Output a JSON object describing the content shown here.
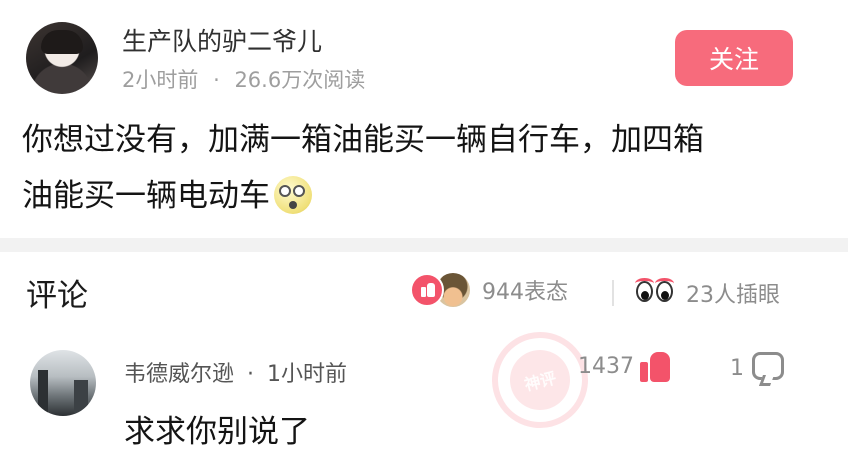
{
  "post": {
    "author": "生产队的驴二爷儿",
    "time": "2小时前",
    "dot": "·",
    "reads": "26.6万次阅读",
    "follow_label": "关注",
    "content_line1": "你想过没有，加满一箱油能买一辆自行车，加四箱",
    "content_line2": "油能买一辆电动车"
  },
  "comments_bar": {
    "title": "评论",
    "reactions": "944表态",
    "pokes": "23人插眼"
  },
  "comment": {
    "author": "韦德威尔逊",
    "dot": "·",
    "time": "1小时前",
    "text": "求求你别说了",
    "likes": "1437",
    "replies": "1",
    "watermark": "神评"
  },
  "colors": {
    "accent": "#f76b7c",
    "like": "#f3536a",
    "muted": "#8c8c8c"
  },
  "icons": [
    "avatar",
    "emoji-shocked-icon",
    "like-icon",
    "helmet-emoji-icon",
    "eyes-icon",
    "thumb-up-icon",
    "reply-icon"
  ]
}
